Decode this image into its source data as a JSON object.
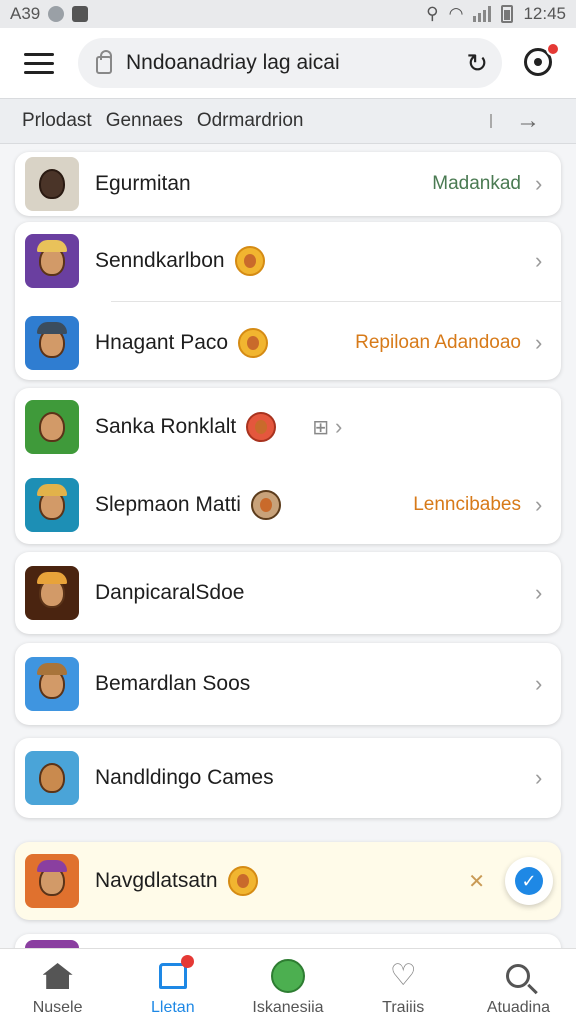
{
  "status_bar": {
    "left_text": "A39",
    "time": "12:45"
  },
  "top_bar": {
    "search_text": "Nndoanadriay lag aicai",
    "reload_icon": "reload-icon",
    "target_icon": "target-icon"
  },
  "tabs": {
    "items": [
      "Prlodast",
      "Gennaes",
      "Odrmardrion"
    ]
  },
  "list": {
    "row1": {
      "name": "Egurmitan",
      "status": "Madankad"
    },
    "row2": {
      "name": "Senndkarlbon"
    },
    "row3": {
      "name": "Hnagant Paco",
      "status": "Repiloan Adandoao"
    },
    "row4": {
      "name": "Sanka Ronklalt"
    },
    "row5": {
      "name": "Slepmaon Matti",
      "status": "Lenncibabes"
    },
    "row6": {
      "name": "DanpicaralSdoe"
    },
    "row7": {
      "name": "Bemardlan Soos"
    },
    "row8": {
      "name": "Nandldingo Cames"
    },
    "row9": {
      "name": "Navgdlatsatn"
    }
  },
  "bottom_nav": {
    "items": [
      "Nusele",
      "Lletan",
      "Iskanesiia",
      "Traiiis",
      "Atuadina"
    ],
    "active": "Lletan"
  },
  "colors": {
    "accent": "#1e88e5",
    "status_green": "#4a7a52",
    "status_orange": "#d77a19",
    "notification": "#e53935"
  }
}
